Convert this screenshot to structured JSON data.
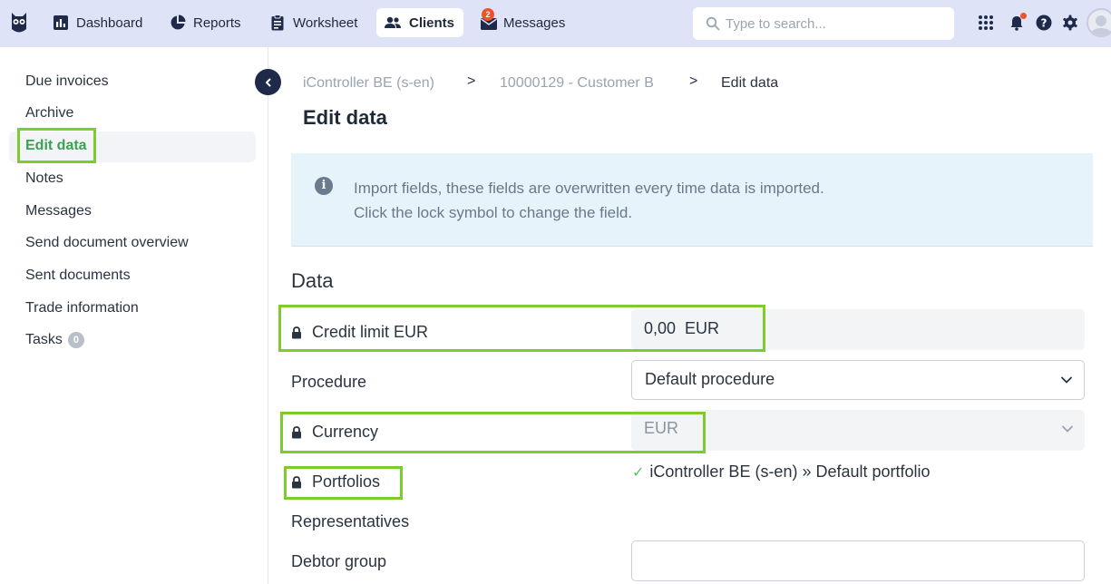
{
  "topbar": {
    "nav": [
      {
        "label": "Dashboard",
        "icon": "bar-chart-icon"
      },
      {
        "label": "Reports",
        "icon": "pie-chart-icon"
      },
      {
        "label": "Worksheet",
        "icon": "clipboard-icon"
      },
      {
        "label": "Clients",
        "icon": "users-icon",
        "active": true
      },
      {
        "label": "Messages",
        "icon": "envelope-icon",
        "badge": "2"
      }
    ],
    "search_placeholder": "Type to search..."
  },
  "sidebar": {
    "items": [
      {
        "label": "Due invoices"
      },
      {
        "label": "Archive"
      },
      {
        "label": "Edit data",
        "active": true
      },
      {
        "label": "Notes"
      },
      {
        "label": "Messages"
      },
      {
        "label": "Send document overview"
      },
      {
        "label": "Sent documents"
      },
      {
        "label": "Trade information"
      },
      {
        "label": "Tasks",
        "count": "0"
      }
    ]
  },
  "breadcrumb": {
    "items": [
      "iController BE (s-en)",
      "10000129 - Customer B",
      "Edit data"
    ],
    "separator": ">"
  },
  "page": {
    "title": "Edit data"
  },
  "info": {
    "line1": "Import fields, these fields are overwritten every time data is imported.",
    "line2": "Click the lock symbol to change the field."
  },
  "data_section": {
    "title": "Data",
    "fields": {
      "credit_limit": {
        "label": "Credit limit EUR",
        "value": "0,00  EUR",
        "locked": true
      },
      "procedure": {
        "label": "Procedure",
        "value": "Default procedure"
      },
      "currency": {
        "label": "Currency",
        "value": "EUR",
        "locked": true
      },
      "portfolios": {
        "label": "Portfolios",
        "value": "iController BE (s-en) » Default portfolio",
        "locked": true
      },
      "representatives": {
        "label": "Representatives"
      },
      "debtor_group": {
        "label": "Debtor group",
        "value": ""
      }
    }
  },
  "colors": {
    "topbar_bg": "#dfe3f7",
    "accent_green": "#3aa153",
    "highlight": "#7ccc2e",
    "info_bg": "#e6f3fb",
    "badge": "#f0522a"
  }
}
